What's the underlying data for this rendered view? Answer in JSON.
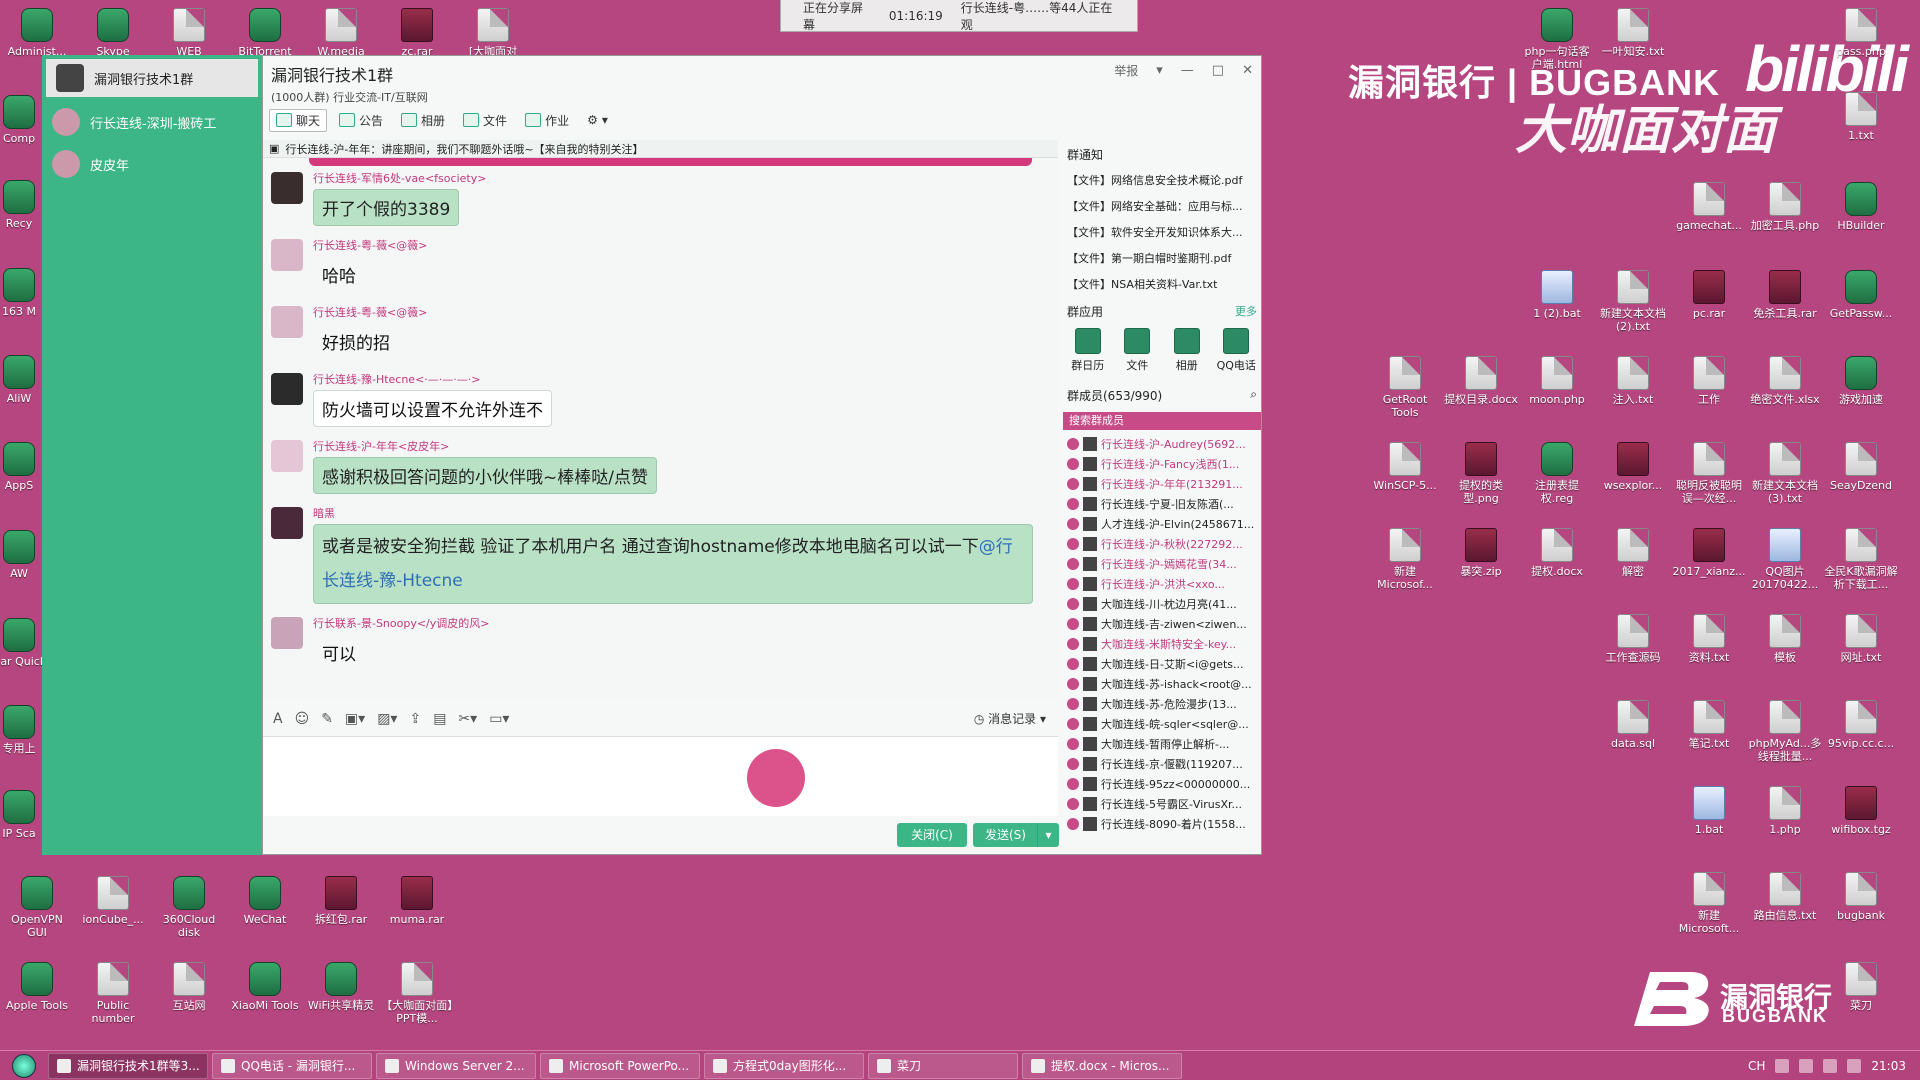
{
  "share_bar": {
    "status": "正在分享屏幕",
    "time": "01:16:19",
    "viewers": "行长连线-粤……等44人正在观"
  },
  "branding": {
    "title": "漏洞银行 | BUGBANK",
    "logo": "bilibili",
    "sub": "大咖面对面",
    "bottom_cn": "漏洞银行",
    "bottom_en": "BUGBANK"
  },
  "desktop_left": [
    {
      "label": "Administ...",
      "kind": "app"
    },
    {
      "label": "Skype",
      "kind": "app"
    },
    {
      "label": "WEB",
      "kind": "doc"
    },
    {
      "label": "BitTorrent",
      "kind": "app"
    },
    {
      "label": "W.media",
      "kind": "doc"
    },
    {
      "label": "zc.rar",
      "kind": "rar"
    },
    {
      "label": "[大咖面对",
      "kind": "doc"
    },
    {
      "label": "Comp",
      "kind": "app"
    },
    {
      "label": "Recy",
      "kind": "app"
    },
    {
      "label": "163 M",
      "kind": "app"
    },
    {
      "label": "AliW",
      "kind": "app"
    },
    {
      "label": "AppS",
      "kind": "app"
    },
    {
      "label": "AW",
      "kind": "app"
    },
    {
      "label": "Gar Quick",
      "kind": "app"
    },
    {
      "label": "专用上",
      "kind": "app"
    },
    {
      "label": "IP Sca",
      "kind": "app"
    }
  ],
  "desktop_bottom": [
    {
      "label": "OpenVPN GUI",
      "kind": "app"
    },
    {
      "label": "ionCube_...",
      "kind": "doc"
    },
    {
      "label": "360Cloud disk",
      "kind": "app"
    },
    {
      "label": "WeChat",
      "kind": "app"
    },
    {
      "label": "拆红包.rar",
      "kind": "rar"
    },
    {
      "label": "muma.rar",
      "kind": "rar"
    },
    {
      "label": "Apple Tools",
      "kind": "app"
    },
    {
      "label": "Public number",
      "kind": "doc"
    },
    {
      "label": "互站网",
      "kind": "doc"
    },
    {
      "label": "XiaoMi Tools",
      "kind": "app"
    },
    {
      "label": "WiFi共享精灵",
      "kind": "app"
    },
    {
      "label": "【大咖面对面】PPT模...",
      "kind": "doc"
    }
  ],
  "desktop_right": [
    {
      "label": "php一句话客户端.html",
      "kind": "app"
    },
    {
      "label": "一叶知安.txt",
      "kind": "doc"
    },
    {
      "label": "pass.php",
      "kind": "doc"
    },
    {
      "label": "1.txt",
      "kind": "doc"
    },
    {
      "label": "gamechat...",
      "kind": "doc"
    },
    {
      "label": "加密工具.php",
      "kind": "doc"
    },
    {
      "label": "HBuilder",
      "kind": "app"
    },
    {
      "label": "1 (2).bat",
      "kind": "img"
    },
    {
      "label": "新建文本文档 (2).txt",
      "kind": "doc"
    },
    {
      "label": "pc.rar",
      "kind": "rar"
    },
    {
      "label": "免杀工具.rar",
      "kind": "rar"
    },
    {
      "label": "GetPassw...",
      "kind": "app"
    },
    {
      "label": "GetRoot Tools",
      "kind": "doc"
    },
    {
      "label": "提权目录.docx",
      "kind": "doc"
    },
    {
      "label": "moon.php",
      "kind": "doc"
    },
    {
      "label": "注入.txt",
      "kind": "doc"
    },
    {
      "label": "工作",
      "kind": "doc"
    },
    {
      "label": "绝密文件.xlsx",
      "kind": "doc"
    },
    {
      "label": "游戏加速",
      "kind": "app"
    },
    {
      "label": "WinSCP-5...",
      "kind": "doc"
    },
    {
      "label": "提权的类型.png",
      "kind": "rar"
    },
    {
      "label": "注册表提权.reg",
      "kind": "app"
    },
    {
      "label": "wsexplor...",
      "kind": "rar"
    },
    {
      "label": "聪明反被聪明误—次经...",
      "kind": "doc"
    },
    {
      "label": "新建文本文档 (3).txt",
      "kind": "doc"
    },
    {
      "label": "SeayDzend",
      "kind": "doc"
    },
    {
      "label": "新建 Microsof...",
      "kind": "doc"
    },
    {
      "label": "暴突.zip",
      "kind": "rar"
    },
    {
      "label": "提权.docx",
      "kind": "doc"
    },
    {
      "label": "解密",
      "kind": "doc"
    },
    {
      "label": "2017_xianz...",
      "kind": "rar"
    },
    {
      "label": "QQ图片20170422...",
      "kind": "img"
    },
    {
      "label": "全民K歌漏洞解析下载工...",
      "kind": "doc"
    },
    {
      "label": "工作查源码",
      "kind": "doc"
    },
    {
      "label": "资料.txt",
      "kind": "doc"
    },
    {
      "label": "模板",
      "kind": "doc"
    },
    {
      "label": "网址.txt",
      "kind": "doc"
    },
    {
      "label": "data.sql",
      "kind": "doc"
    },
    {
      "label": "笔记.txt",
      "kind": "doc"
    },
    {
      "label": "phpMyAd...多线程批量...",
      "kind": "doc"
    },
    {
      "label": "95vip.cc.c...",
      "kind": "doc"
    },
    {
      "label": "1.bat",
      "kind": "img"
    },
    {
      "label": "1.php",
      "kind": "doc"
    },
    {
      "label": "wifibox.tgz",
      "kind": "rar"
    },
    {
      "label": "新建 Microsoft...",
      "kind": "doc"
    },
    {
      "label": "路由信息.txt",
      "kind": "doc"
    },
    {
      "label": "bugbank",
      "kind": "doc"
    },
    {
      "label": "菜刀",
      "kind": "doc"
    }
  ],
  "conversations": [
    {
      "name": "漏洞银行技术1群",
      "active": true
    },
    {
      "name": "行长连线-深圳-搬砖工",
      "active": false
    },
    {
      "name": "皮皮年",
      "active": false
    }
  ],
  "window": {
    "title": "漏洞银行技术1群",
    "meta": "(1000人群) 行业交流-IT/互联网",
    "report": "举报",
    "tabs": [
      "聊天",
      "公告",
      "相册",
      "文件",
      "作业"
    ],
    "notice": "行长连线-沪-年年：讲座期间，我们不聊题外话哦~【来自我的特别关注】"
  },
  "messages": [
    {
      "sender": "行长连线-军情6处-vae<fsociety>",
      "text": "开了个假的3389",
      "style": "green"
    },
    {
      "sender": "行长连线-粤-薇<@薇>",
      "text": "哈哈",
      "style": "plain"
    },
    {
      "sender": "行长连线-粤-薇<@薇>",
      "text": "好损的招",
      "style": "plain"
    },
    {
      "sender": "行长连线-豫-Htecne<·—·—·—·>",
      "text": "防火墙可以设置不允许外连不",
      "style": "white"
    },
    {
      "sender": "行长连线-沪-年年<皮皮年>",
      "text": "感谢积极回答问题的小伙伴哦~棒棒哒/点赞",
      "style": "green"
    },
    {
      "sender": "暗黑",
      "text": "或者是被安全狗拦截  验证了本机用户名  通过查询hostname修改本地电脑名可以试一下",
      "at": "@行长连线-豫-Htecne",
      "style": "green"
    },
    {
      "sender": "行长联系-景-Snoopy</y调皮的风>",
      "text": "可以",
      "style": "plain"
    }
  ],
  "composer": {
    "history": "消息记录",
    "close": "关闭(C)",
    "send": "发送(S)"
  },
  "sidebar": {
    "notice_h": "群通知",
    "files": [
      "【文件】网络信息安全技术概论.pdf",
      "【文件】网络安全基础：应用与标...",
      "【文件】软件安全开发知识体系大...",
      "【文件】第一期白帽时鉴期刊.pdf",
      "【文件】NSA相关资料-Var.txt"
    ],
    "apps_h": "群应用",
    "apps_more": "更多",
    "apps": [
      "群日历",
      "文件",
      "相册",
      "QQ电话"
    ],
    "members_h": "群成员(653/990)",
    "member_search": "搜索群成员",
    "members": [
      {
        "name": "行长连线-沪-Audrey(5692...",
        "p": true
      },
      {
        "name": "行长连线-沪-Fancy浅西(1...",
        "p": true
      },
      {
        "name": "行长连线-沪-年年(213291...",
        "p": true
      },
      {
        "name": "行长连线-宁夏-旧友陈酒(...",
        "p": false
      },
      {
        "name": "人才连线-沪-Elvin(2458671...",
        "p": false
      },
      {
        "name": "行长连线-沪-秋秋(227292...",
        "p": true
      },
      {
        "name": "行长连线-沪-嫣嫣花雪(34...",
        "p": true
      },
      {
        "name": "行长连线-沪-洪洪<xxo...",
        "p": true
      },
      {
        "name": "大咖连线-川-枕边月亮(41...",
        "p": false
      },
      {
        "name": "大咖连线-吉-ziwen<ziwen...",
        "p": false
      },
      {
        "name": "大咖连线-米斯特安全-key...",
        "p": true
      },
      {
        "name": "大咖连线-日-艾斯<i@gets...",
        "p": false
      },
      {
        "name": "大咖连线-苏-ishack<root@...",
        "p": false
      },
      {
        "name": "大咖连线-苏-危险漫步(13...",
        "p": false
      },
      {
        "name": "大咖连线-皖-sqler<sqler@...",
        "p": false
      },
      {
        "name": "大咖连线-暂雨停止解析-...",
        "p": false
      },
      {
        "name": "行长连线-京-偃戳(119207...",
        "p": false
      },
      {
        "name": "行长连线-95zz<00000000...",
        "p": false
      },
      {
        "name": "行长连线-5号霸区-VirusXr...",
        "p": false
      },
      {
        "name": "行长连线-8090-着片(1558...",
        "p": false
      }
    ]
  },
  "taskbar": {
    "tasks": [
      "漏洞银行技术1群等3...",
      "QQ电话 - 漏洞银行...",
      "Windows Server 2...",
      "Microsoft PowerPo...",
      "方程式0day图形化...",
      "菜刀",
      "提权.docx - Micros..."
    ],
    "ime": "CH",
    "time": "21:03"
  }
}
